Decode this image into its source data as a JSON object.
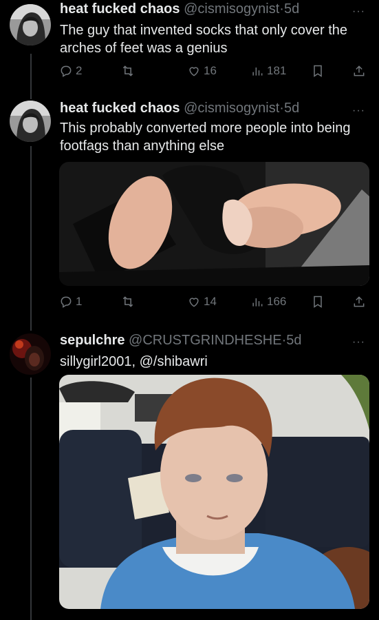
{
  "tweets": [
    {
      "name": "heat fucked chaos",
      "handle": "@cismisogynist",
      "sep": "·",
      "time": "5d",
      "text": "The guy that invented socks that only cover the arches of feet was a genius",
      "replies": "2",
      "likes": "16",
      "views": "181"
    },
    {
      "name": "heat fucked chaos",
      "handle": "@cismisogynist",
      "sep": "·",
      "time": "5d",
      "text": "This probably converted more people into being footfags than anything else",
      "replies": "1",
      "likes": "14",
      "views": "166"
    },
    {
      "name": "sepulchre",
      "handle": "@CRUSTGRINDHESHE",
      "sep": "·",
      "time": "5d",
      "text": "sillygirl2001, @/shibawri"
    }
  ],
  "more_label": "···",
  "icons": [
    "reply-icon",
    "retweet-icon",
    "like-icon",
    "views-icon",
    "bookmark-icon",
    "share-icon",
    "more-icon"
  ],
  "colors": {
    "background": "#000000",
    "text": "#e7e9ea",
    "secondary": "#71767b",
    "thread": "#333639"
  }
}
